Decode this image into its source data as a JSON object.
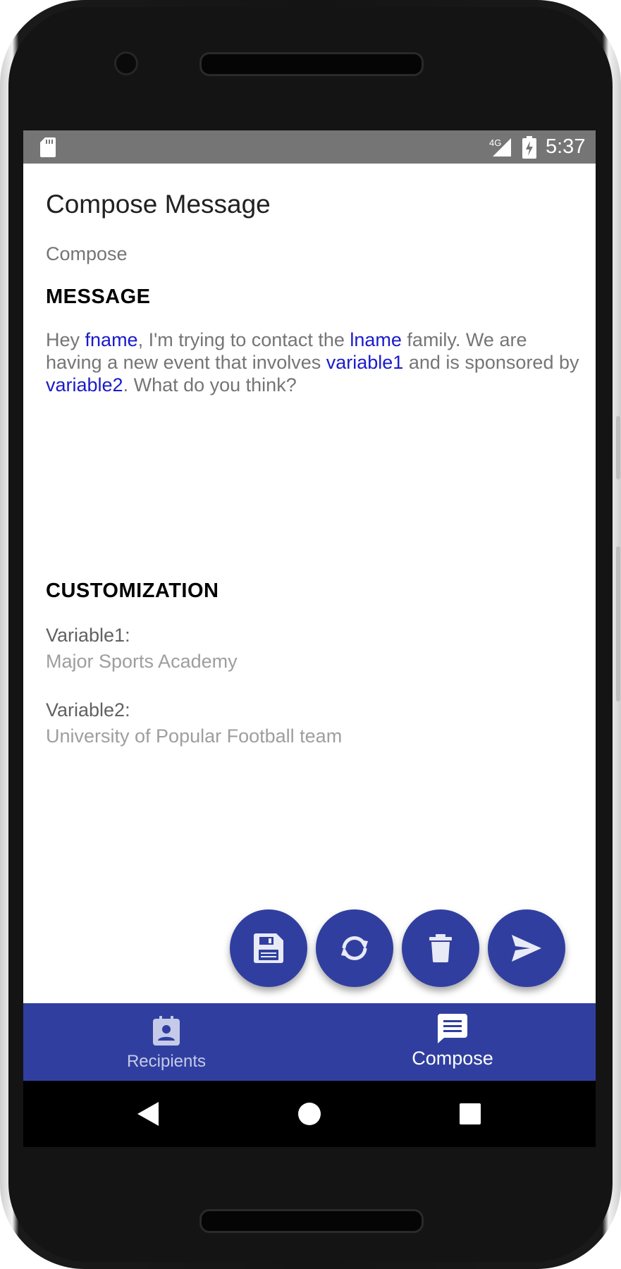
{
  "status_bar": {
    "time": "5:37",
    "network": "4G",
    "icons": [
      "sd-card-icon",
      "signal-4g-icon",
      "battery-charging-icon"
    ]
  },
  "page": {
    "title": "Compose Message",
    "subtitle": "Compose"
  },
  "message": {
    "heading": "MESSAGE",
    "segments": {
      "t1": "Hey ",
      "v1": "fname",
      "t2": ", I'm trying to contact the ",
      "v2": "lname",
      "t3": " family. We are having a new event that involves ",
      "v3": "variable1",
      "t4": " and is sponsored by ",
      "v4": "variable2",
      "t5": ". What do you think?"
    }
  },
  "customization": {
    "heading": "CUSTOMIZATION",
    "variable1_label": "Variable1:",
    "variable1_value": "Major Sports Academy",
    "variable2_label": "Variable2:",
    "variable2_value": "University of Popular Football team"
  },
  "actions": [
    "save-icon",
    "sync-icon",
    "delete-icon",
    "send-icon"
  ],
  "bottom_nav": {
    "items": [
      {
        "label": "Recipients",
        "icon": "contact-icon",
        "active": false
      },
      {
        "label": "Compose",
        "icon": "message-icon",
        "active": true
      }
    ]
  },
  "colors": {
    "primary": "#303f9f",
    "variable_highlight": "#1a1acc",
    "status_bar": "#757575"
  }
}
